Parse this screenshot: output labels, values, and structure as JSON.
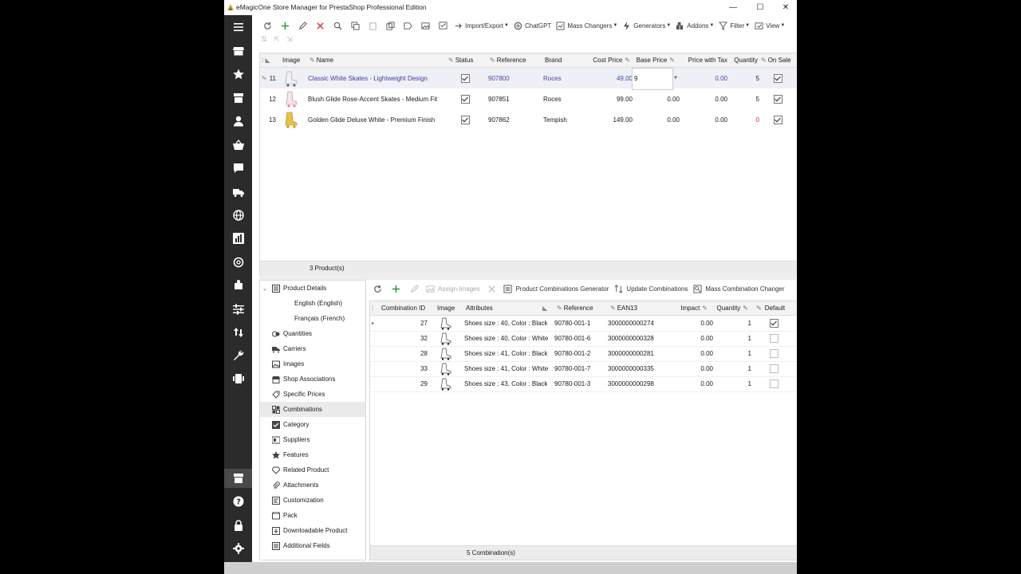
{
  "window": {
    "title": "eMagicOne Store Manager for PrestaShop Professional Edition",
    "minimize": "—",
    "maximize": "☐",
    "close": "✕"
  },
  "toolbar": {
    "import_export": "Import/Export",
    "chatgpt": "ChatGPT",
    "mass_changers": "Mass Changers",
    "generators": "Generators",
    "addons": "Addons",
    "filter": "Filter",
    "view": "View"
  },
  "products": {
    "columns": {
      "image": "Image",
      "name": "Name",
      "status": "Status",
      "reference": "Reference",
      "brand": "Brand",
      "cost_price": "Cost Price",
      "base_price": "Base Price",
      "price_with_tax": "Price with Tax",
      "quantity": "Quantity",
      "on_sale": "On Sale"
    },
    "rows": [
      {
        "id": "11",
        "name": "Classic White Skates - Lightweight Design",
        "status": true,
        "reference": "907800",
        "brand": "Roces",
        "cost_price": "49.00",
        "base_price": "9",
        "price_with_tax": "0.00",
        "quantity": "5",
        "on_sale": true
      },
      {
        "id": "12",
        "name": "Blush Glide Rose-Accent Skates - Medium Fit",
        "status": true,
        "reference": "907851",
        "brand": "Roces",
        "cost_price": "99.00",
        "base_price": "0.00",
        "price_with_tax": "0.00",
        "quantity": "5",
        "on_sale": true
      },
      {
        "id": "13",
        "name": "Golden Glide Deluxe White - Premium Finish",
        "status": true,
        "reference": "907862",
        "brand": "Tempish",
        "cost_price": "149.00",
        "base_price": "0.00",
        "price_with_tax": "0.00",
        "quantity": "0",
        "on_sale": true
      }
    ],
    "footer": "3 Product(s)"
  },
  "tree": {
    "items": [
      {
        "label": "Product Details",
        "icon": "details-icon"
      },
      {
        "label": "English (English)",
        "sub": true
      },
      {
        "label": "Français (French)",
        "sub": true
      },
      {
        "label": "Quantities",
        "icon": "quantities-icon"
      },
      {
        "label": "Carriers",
        "icon": "carriers-icon"
      },
      {
        "label": "Images",
        "icon": "images-icon"
      },
      {
        "label": "Shop Associations",
        "icon": "shop-icon"
      },
      {
        "label": "Specific Prices",
        "icon": "tag-icon"
      },
      {
        "label": "Combinations",
        "icon": "combinations-icon"
      },
      {
        "label": "Category",
        "icon": "category-icon"
      },
      {
        "label": "Suppliers",
        "icon": "suppliers-icon"
      },
      {
        "label": "Features",
        "icon": "star-icon"
      },
      {
        "label": "Related Product",
        "icon": "diamond-icon"
      },
      {
        "label": "Attachments",
        "icon": "paperclip-icon"
      },
      {
        "label": "Customization",
        "icon": "customization-icon"
      },
      {
        "label": "Pack",
        "icon": "pack-icon"
      },
      {
        "label": "Downloadable Product",
        "icon": "download-icon"
      },
      {
        "label": "Additional Fields",
        "icon": "fields-icon"
      }
    ]
  },
  "combo_toolbar": {
    "assign_images": "Assign Images",
    "generator": "Product Combinations Generator",
    "update": "Update Combinations",
    "mass_changer": "Mass Combination Changer"
  },
  "combinations": {
    "columns": {
      "id": "Combination ID",
      "image": "Image",
      "attributes": "Attributes",
      "reference": "Reference",
      "ean13": "EAN13",
      "impact": "Impact",
      "quantity": "Quantity",
      "default": "Default"
    },
    "rows": [
      {
        "id": "27",
        "attributes": "Shoes size : 40, Color : Black",
        "reference": "90780-001-1",
        "ean13": "3000000000274",
        "impact": "0.00",
        "quantity": "1",
        "default": true
      },
      {
        "id": "32",
        "attributes": "Shoes size : 40, Color : White",
        "reference": "90780-001-6",
        "ean13": "3000000000328",
        "impact": "0.00",
        "quantity": "1",
        "default": false
      },
      {
        "id": "28",
        "attributes": "Shoes size : 41, Color : Black",
        "reference": "90780-001-2",
        "ean13": "3000000000281",
        "impact": "0.00",
        "quantity": "1",
        "default": false
      },
      {
        "id": "33",
        "attributes": "Shoes size : 41, Color : White",
        "reference": "90780-001-7",
        "ean13": "3000000000335",
        "impact": "0.00",
        "quantity": "1",
        "default": false
      },
      {
        "id": "29",
        "attributes": "Shoes size : 43, Color : Black",
        "reference": "90780-001-3",
        "ean13": "3000000000298",
        "impact": "0.00",
        "quantity": "1",
        "default": false
      }
    ],
    "footer": "5 Combination(s)"
  }
}
